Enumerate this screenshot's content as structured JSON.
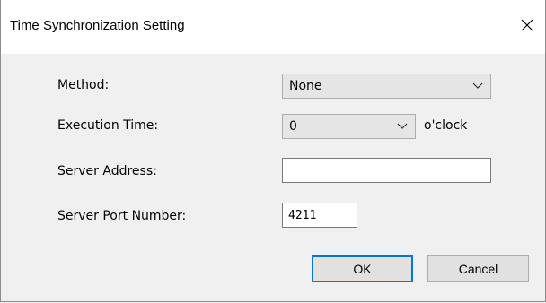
{
  "dialog": {
    "title": "Time Synchronization Setting",
    "close_icon": "close-x-icon"
  },
  "form": {
    "method": {
      "label": "Method:",
      "value": "None"
    },
    "execution_time": {
      "label": "Execution Time:",
      "value": "0",
      "suffix": "o'clock"
    },
    "server_address": {
      "label": "Server Address:",
      "value": ""
    },
    "server_port": {
      "label": "Server Port Number:",
      "value": "4211"
    }
  },
  "buttons": {
    "ok_label": "OK",
    "cancel_label": "Cancel"
  },
  "colors": {
    "focus_border": "#0078d7"
  }
}
